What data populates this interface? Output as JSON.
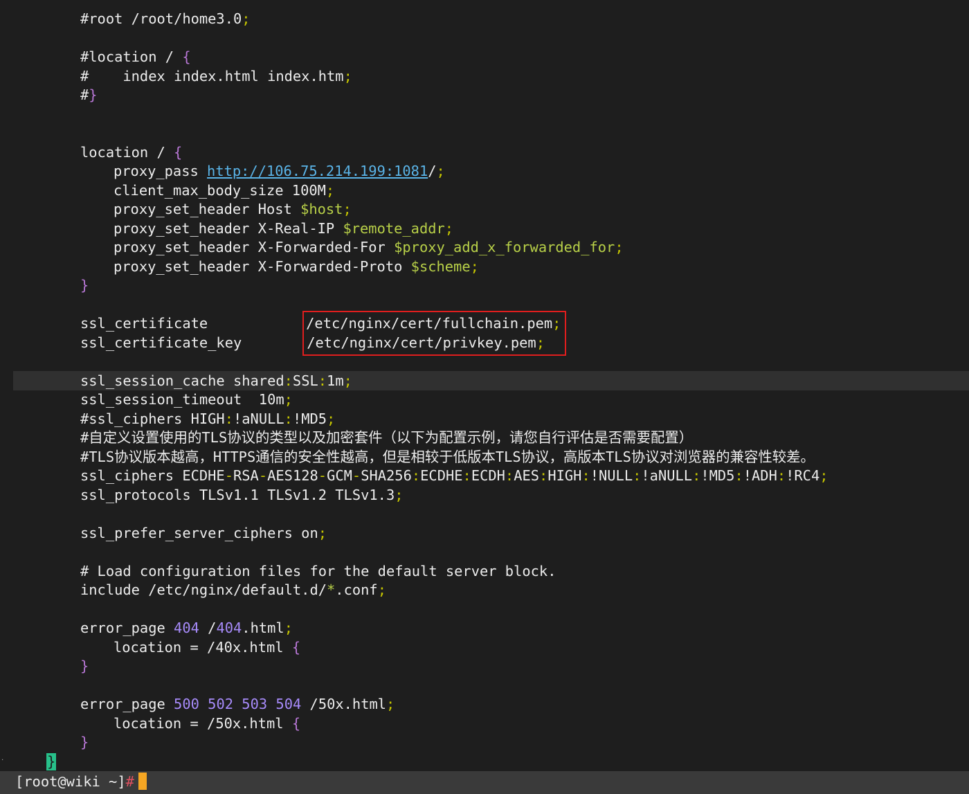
{
  "lines": {
    "l1": "#root /root/home3.0",
    "l2a": "#location / ",
    "l3a": "#    index index.html index.htm",
    "l4a": "#",
    "l5a": "location / ",
    "l6a": "proxy_pass ",
    "l6url": "http://106.75.214.199:1081",
    "l6b": "/",
    "l7a": "client_max_body_size 100M",
    "l8a": "proxy_set_header Host ",
    "l8var": "$host",
    "l9a": "proxy_set_header X-Real-IP ",
    "l9var": "$remote_addr",
    "l10a": "proxy_set_header X-Forwarded-For ",
    "l10var": "$proxy_add_x_forwarded_for",
    "l11a": "proxy_set_header X-Forwarded-Proto ",
    "l11var": "$scheme",
    "l13a": "ssl_certificate",
    "l13b": "/etc/nginx/cert/fullchain.pem",
    "l14a": "ssl_certificate_key",
    "l14b": "/etc/nginx/cert/privkey.pem",
    "l15a": "ssl_session_cache shared",
    "l15b": "SSL",
    "l15c": "1m",
    "l16a": "ssl_session_timeout  10m",
    "l17a": "#ssl_ciphers HIGH",
    "l17b": "!aNULL",
    "l17c": "!MD5",
    "l18": "#自定义设置使用的TLS协议的类型以及加密套件（以下为配置示例，请您自行评估是否需要配置）",
    "l19": "#TLS协议版本越高，HTTPS通信的安全性越高，但是相较于低版本TLS协议，高版本TLS协议对浏览器的兼容性较差。",
    "l20a": "ssl_ciphers ECDHE",
    "l20b": "RSA",
    "l20c": "AES128",
    "l20d": "GCM",
    "l20e": "SHA256",
    "l20f": "ECDHE",
    "l20g": "ECDH",
    "l20h": "AES",
    "l20i": "HIGH",
    "l20j": "!NULL",
    "l20k": "!aNULL",
    "l20l": "!MD5",
    "l20m": "!ADH",
    "l20n": "!RC4",
    "l21a": "ssl_protocols TLSv1.1 TLSv1.2 TLSv1.3",
    "l22a": "ssl_prefer_server_ciphers on",
    "l23": "# Load configuration files for the default server block.",
    "l24a": "include /etc/nginx/default.d/",
    "l24b": ".conf",
    "l25a": "error_page ",
    "l25n": "404",
    "l25b": " /",
    "l25n2": "404",
    "l25c": ".html",
    "l26a": "location = /40x.html ",
    "l28a": "error_page ",
    "l28n1": "500",
    "l28n2": "502",
    "l28n3": "503",
    "l28n4": "504",
    "l28b": " /50x.html",
    "l29a": "location = /50x.html "
  },
  "prompt": {
    "text": "[root@wiki ~]",
    "hash": "#"
  }
}
